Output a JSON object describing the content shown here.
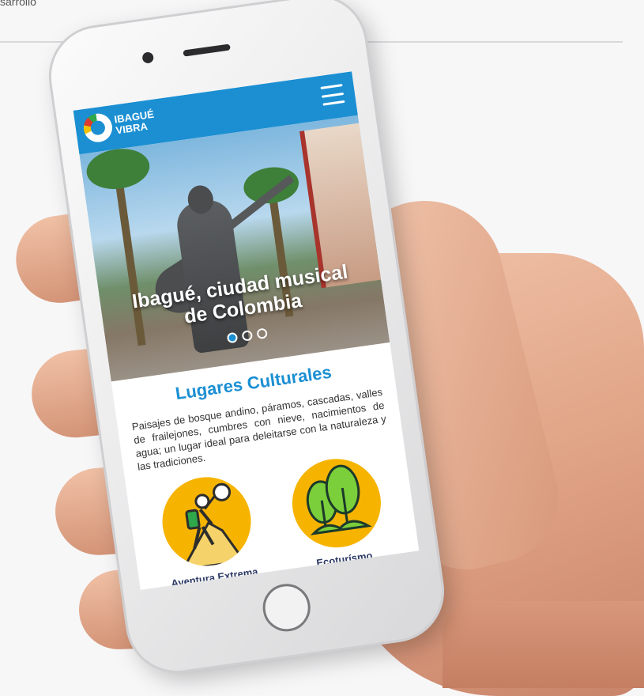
{
  "corner_text": "sarrollo",
  "app": {
    "logo_line1": "IBAGUÉ",
    "logo_line2": "VIBRA",
    "hero": {
      "title_line1": "Ibagué, ciudad musical",
      "title_line2": "de Colombia",
      "slides": 3,
      "active_slide": 1
    },
    "section": {
      "title": "Lugares Culturales",
      "text": "Paisajes de bosque andino, páramos, cascadas, valles de frailejones, cumbres con nieve, nacimientos de agua; un lugar ideal para deleitarse con la naturaleza y las tradiciones."
    },
    "cards": [
      {
        "label": "Aventura Extrema",
        "icon": "climber-icon"
      },
      {
        "label": "Ecoturísmo",
        "icon": "trees-icon"
      }
    ]
  },
  "colors": {
    "brand_blue": "#1b8fd2",
    "accent_yellow": "#f6b400",
    "card_label": "#2d3a66"
  }
}
